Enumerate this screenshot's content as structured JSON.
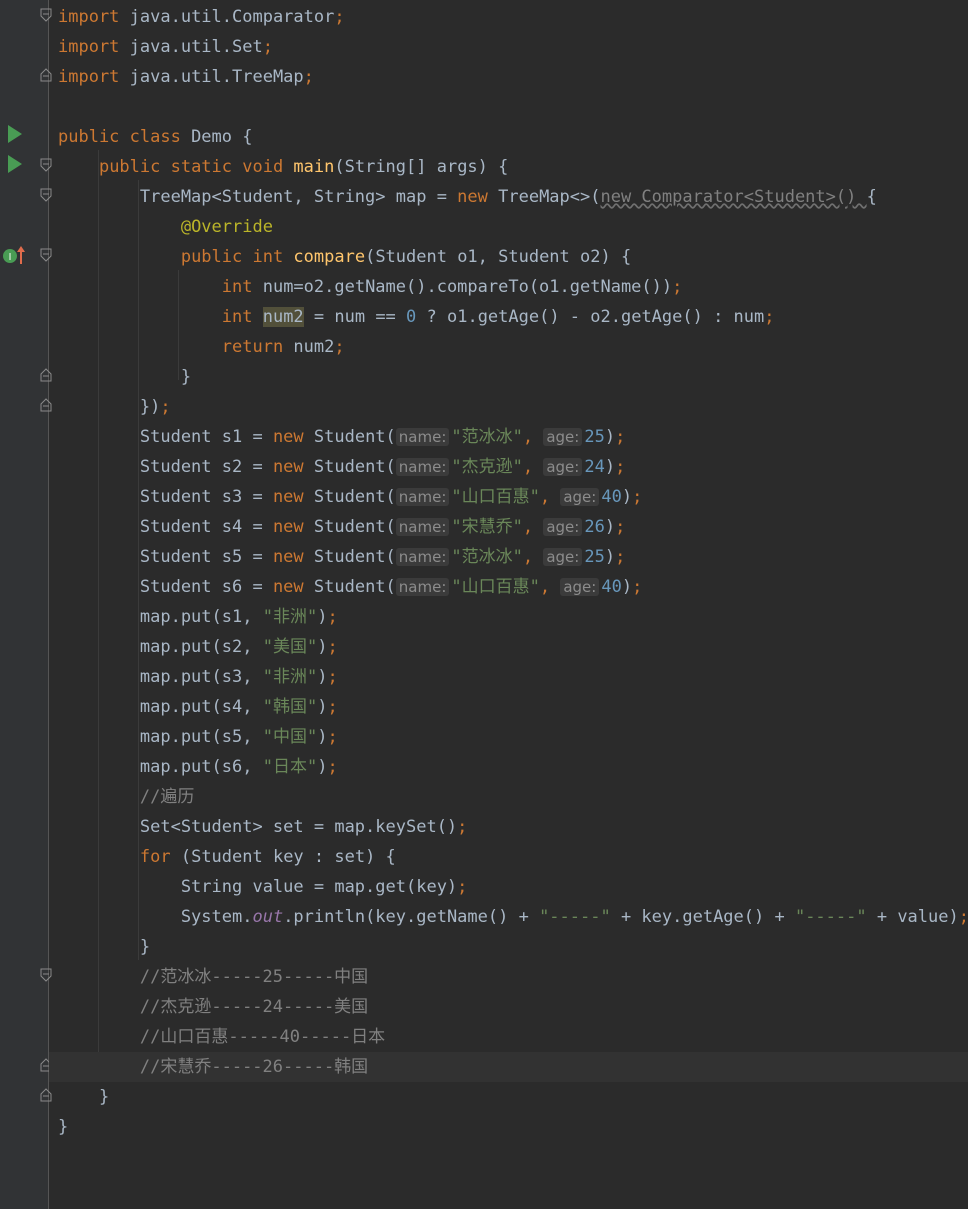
{
  "editor": {
    "lines": [
      {
        "segments": [
          {
            "t": "import",
            "c": "kw"
          },
          {
            "t": " java.util.Comparator"
          },
          {
            "t": ";",
            "c": "kw"
          }
        ]
      },
      {
        "segments": [
          {
            "t": "import",
            "c": "kw"
          },
          {
            "t": " java.util.Set"
          },
          {
            "t": ";",
            "c": "kw"
          }
        ]
      },
      {
        "segments": [
          {
            "t": "import",
            "c": "kw"
          },
          {
            "t": " java.util.TreeMap"
          },
          {
            "t": ";",
            "c": "kw"
          }
        ]
      },
      {
        "segments": []
      },
      {
        "segments": [
          {
            "t": "public class ",
            "c": "kw"
          },
          {
            "t": "Demo {"
          }
        ]
      },
      {
        "segments": [
          {
            "t": "    "
          },
          {
            "t": "public static void ",
            "c": "kw"
          },
          {
            "t": "main",
            "c": "fn"
          },
          {
            "t": "(String[] args) {"
          }
        ]
      },
      {
        "segments": [
          {
            "t": "        TreeMap<Student, String> map = "
          },
          {
            "t": "new ",
            "c": "kw"
          },
          {
            "t": "TreeMap<>("
          },
          {
            "t": "new Comparator<Student>() ",
            "c": "wavy"
          },
          {
            "t": "{"
          }
        ]
      },
      {
        "segments": [
          {
            "t": "            "
          },
          {
            "t": "@Override",
            "c": "ann"
          }
        ]
      },
      {
        "segments": [
          {
            "t": "            "
          },
          {
            "t": "public int ",
            "c": "kw"
          },
          {
            "t": "compare",
            "c": "fn"
          },
          {
            "t": "(Student o1, Student o2) {"
          }
        ]
      },
      {
        "segments": [
          {
            "t": "                "
          },
          {
            "t": "int ",
            "c": "kw"
          },
          {
            "t": "num=o2.getName().compareTo(o1.getName())"
          },
          {
            "t": ";",
            "c": "kw"
          }
        ]
      },
      {
        "segments": [
          {
            "t": "                "
          },
          {
            "t": "int ",
            "c": "kw"
          },
          {
            "t": "num2",
            "c": "hl"
          },
          {
            "t": " = num == "
          },
          {
            "t": "0",
            "c": "num"
          },
          {
            "t": " ? o1.getAge() - o2.getAge() : num"
          },
          {
            "t": ";",
            "c": "kw"
          }
        ]
      },
      {
        "segments": [
          {
            "t": "                "
          },
          {
            "t": "return ",
            "c": "kw"
          },
          {
            "t": "num2"
          },
          {
            "t": ";",
            "c": "kw"
          }
        ]
      },
      {
        "segments": [
          {
            "t": "            }"
          }
        ]
      },
      {
        "segments": [
          {
            "t": "        })"
          },
          {
            "t": ";",
            "c": "kw"
          }
        ]
      },
      {
        "segments": [
          {
            "t": "        Student s1 = "
          },
          {
            "t": "new ",
            "c": "kw"
          },
          {
            "t": "Student("
          },
          {
            "t": "name:",
            "c": "hint"
          },
          {
            "t": "\"范冰冰\"",
            "c": "str"
          },
          {
            "t": ", ",
            "c": "kw"
          },
          {
            "t": "age:",
            "c": "hint"
          },
          {
            "t": "25",
            "c": "num"
          },
          {
            "t": ")"
          },
          {
            "t": ";",
            "c": "kw"
          }
        ]
      },
      {
        "segments": [
          {
            "t": "        Student s2 = "
          },
          {
            "t": "new ",
            "c": "kw"
          },
          {
            "t": "Student("
          },
          {
            "t": "name:",
            "c": "hint"
          },
          {
            "t": "\"杰克逊\"",
            "c": "str"
          },
          {
            "t": ", ",
            "c": "kw"
          },
          {
            "t": "age:",
            "c": "hint"
          },
          {
            "t": "24",
            "c": "num"
          },
          {
            "t": ")"
          },
          {
            "t": ";",
            "c": "kw"
          }
        ]
      },
      {
        "segments": [
          {
            "t": "        Student s3 = "
          },
          {
            "t": "new ",
            "c": "kw"
          },
          {
            "t": "Student("
          },
          {
            "t": "name:",
            "c": "hint"
          },
          {
            "t": "\"山口百惠\"",
            "c": "str"
          },
          {
            "t": ", ",
            "c": "kw"
          },
          {
            "t": "age:",
            "c": "hint"
          },
          {
            "t": "40",
            "c": "num"
          },
          {
            "t": ")"
          },
          {
            "t": ";",
            "c": "kw"
          }
        ]
      },
      {
        "segments": [
          {
            "t": "        Student s4 = "
          },
          {
            "t": "new ",
            "c": "kw"
          },
          {
            "t": "Student("
          },
          {
            "t": "name:",
            "c": "hint"
          },
          {
            "t": "\"宋慧乔\"",
            "c": "str"
          },
          {
            "t": ", ",
            "c": "kw"
          },
          {
            "t": "age:",
            "c": "hint"
          },
          {
            "t": "26",
            "c": "num"
          },
          {
            "t": ")"
          },
          {
            "t": ";",
            "c": "kw"
          }
        ]
      },
      {
        "segments": [
          {
            "t": "        Student s5 = "
          },
          {
            "t": "new ",
            "c": "kw"
          },
          {
            "t": "Student("
          },
          {
            "t": "name:",
            "c": "hint"
          },
          {
            "t": "\"范冰冰\"",
            "c": "str"
          },
          {
            "t": ", ",
            "c": "kw"
          },
          {
            "t": "age:",
            "c": "hint"
          },
          {
            "t": "25",
            "c": "num"
          },
          {
            "t": ")"
          },
          {
            "t": ";",
            "c": "kw"
          }
        ]
      },
      {
        "segments": [
          {
            "t": "        Student s6 = "
          },
          {
            "t": "new ",
            "c": "kw"
          },
          {
            "t": "Student("
          },
          {
            "t": "name:",
            "c": "hint"
          },
          {
            "t": "\"山口百惠\"",
            "c": "str"
          },
          {
            "t": ", ",
            "c": "kw"
          },
          {
            "t": "age:",
            "c": "hint"
          },
          {
            "t": "40",
            "c": "num"
          },
          {
            "t": ")"
          },
          {
            "t": ";",
            "c": "kw"
          }
        ]
      },
      {
        "segments": [
          {
            "t": "        map.put(s1, "
          },
          {
            "t": "\"非洲\"",
            "c": "str"
          },
          {
            "t": ")"
          },
          {
            "t": ";",
            "c": "kw"
          }
        ]
      },
      {
        "segments": [
          {
            "t": "        map.put(s2, "
          },
          {
            "t": "\"美国\"",
            "c": "str"
          },
          {
            "t": ")"
          },
          {
            "t": ";",
            "c": "kw"
          }
        ]
      },
      {
        "segments": [
          {
            "t": "        map.put(s3, "
          },
          {
            "t": "\"非洲\"",
            "c": "str"
          },
          {
            "t": ")"
          },
          {
            "t": ";",
            "c": "kw"
          }
        ]
      },
      {
        "segments": [
          {
            "t": "        map.put(s4, "
          },
          {
            "t": "\"韩国\"",
            "c": "str"
          },
          {
            "t": ")"
          },
          {
            "t": ";",
            "c": "kw"
          }
        ]
      },
      {
        "segments": [
          {
            "t": "        map.put(s5, "
          },
          {
            "t": "\"中国\"",
            "c": "str"
          },
          {
            "t": ")"
          },
          {
            "t": ";",
            "c": "kw"
          }
        ]
      },
      {
        "segments": [
          {
            "t": "        map.put(s6, "
          },
          {
            "t": "\"日本\"",
            "c": "str"
          },
          {
            "t": ")"
          },
          {
            "t": ";",
            "c": "kw"
          }
        ]
      },
      {
        "segments": [
          {
            "t": "        "
          },
          {
            "t": "//遍历",
            "c": "cmt"
          }
        ]
      },
      {
        "segments": [
          {
            "t": "        Set<Student> set = map.keySet()"
          },
          {
            "t": ";",
            "c": "kw"
          }
        ]
      },
      {
        "segments": [
          {
            "t": "        "
          },
          {
            "t": "for ",
            "c": "kw"
          },
          {
            "t": "(Student key : set) {"
          }
        ]
      },
      {
        "segments": [
          {
            "t": "            String value = map.get(key)"
          },
          {
            "t": ";",
            "c": "kw"
          }
        ]
      },
      {
        "segments": [
          {
            "t": "            System."
          },
          {
            "t": "out",
            "c": "ital"
          },
          {
            "t": ".println(key.getName() + "
          },
          {
            "t": "\"-----\"",
            "c": "str"
          },
          {
            "t": " + key.getAge() + "
          },
          {
            "t": "\"-----\"",
            "c": "str"
          },
          {
            "t": " + value)"
          },
          {
            "t": ";",
            "c": "kw"
          }
        ]
      },
      {
        "segments": [
          {
            "t": "        }"
          }
        ]
      },
      {
        "segments": [
          {
            "t": "        "
          },
          {
            "t": "//范冰冰-----25-----中国",
            "c": "cmt"
          }
        ]
      },
      {
        "segments": [
          {
            "t": "        "
          },
          {
            "t": "//杰克逊-----24-----美国",
            "c": "cmt"
          }
        ]
      },
      {
        "segments": [
          {
            "t": "        "
          },
          {
            "t": "//山口百惠-----40-----日本",
            "c": "cmt"
          }
        ]
      },
      {
        "segments": [
          {
            "t": "        "
          },
          {
            "t": "//宋慧乔-----26-----韩国",
            "c": "cmt"
          }
        ]
      },
      {
        "segments": [
          {
            "t": "    }"
          }
        ]
      },
      {
        "segments": [
          {
            "t": "}"
          }
        ]
      }
    ],
    "current_line_index": 35,
    "gutter": {
      "run_icon": "run-triangle-icon",
      "implement_icon": "implements-method-icon",
      "implement_icon_letter": "I",
      "fold_icon": "fold-marker-icon"
    },
    "colors": {
      "background": "#2b2b2b",
      "gutter": "#313335",
      "keyword": "#cc7832",
      "string": "#6a8759",
      "number": "#6897bb",
      "function": "#ffc66d",
      "annotation": "#bbb529",
      "comment": "#808080",
      "run_icon": "#499c54"
    }
  }
}
